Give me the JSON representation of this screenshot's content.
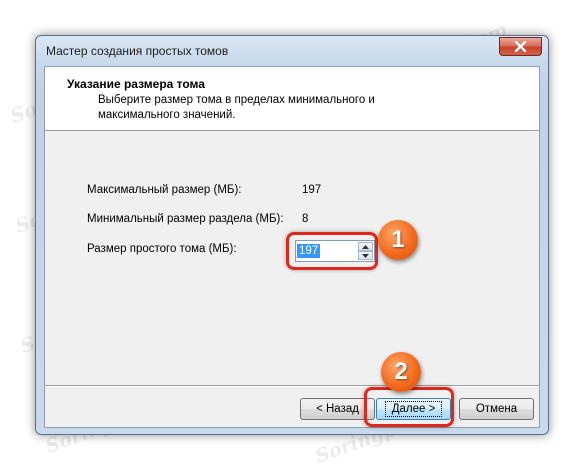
{
  "window": {
    "title": "Мастер создания простых томов"
  },
  "header": {
    "title": "Указание размера тома",
    "description": "Выберите размер тома в пределах минимального и максимального значений."
  },
  "fields": {
    "max_size_label": "Максимальный размер (МБ):",
    "max_size_value": "197",
    "min_size_label": "Минимальный размер раздела (МБ):",
    "min_size_value": "8",
    "volume_size_label": "Размер простого тома (МБ):",
    "volume_size_value": "197"
  },
  "buttons": {
    "back": "< Назад",
    "next": "Далее >",
    "cancel": "Отмена"
  },
  "annotations": {
    "badge_1": "1",
    "badge_2": "2",
    "color": "#e0271d"
  },
  "watermark": "Soringpcrepair.Com",
  "icons": {
    "close": "close-icon",
    "spin_up": "chevron-up-icon",
    "spin_down": "chevron-down-icon"
  }
}
